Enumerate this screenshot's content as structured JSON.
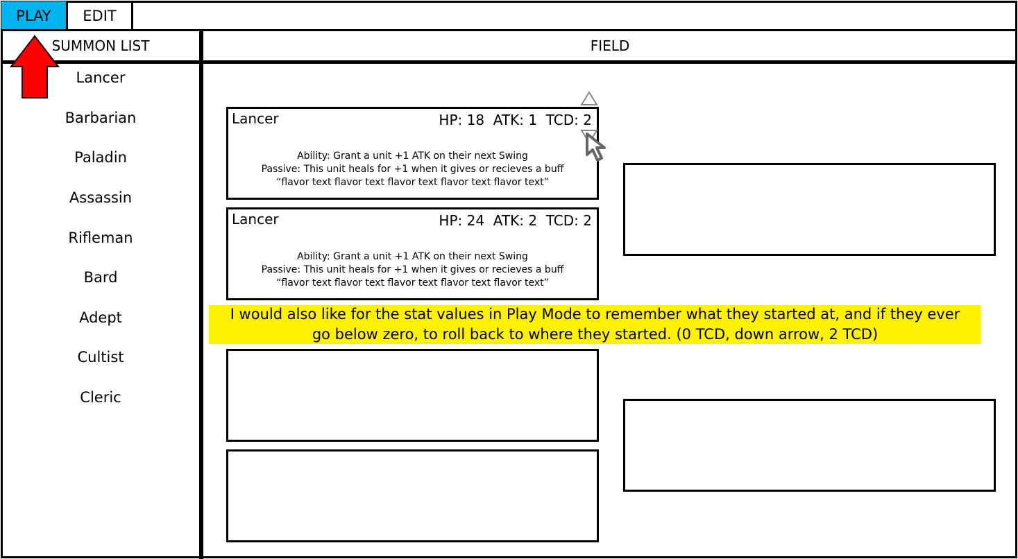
{
  "tabs": {
    "play": "PLAY",
    "edit": "EDIT"
  },
  "headers": {
    "summon_list": "SUMMON LIST",
    "field": "FIELD"
  },
  "summon_list": [
    "Lancer",
    "Barbarian",
    "Paladin",
    "Assassin",
    "Rifleman",
    "Bard",
    "Adept",
    "Cultist",
    "Cleric"
  ],
  "cards": [
    {
      "name": "Lancer",
      "stats": "HP: 18  ATK: 1  TCD: 2",
      "ability": "Ability: Grant a unit +1 ATK on their next Swing",
      "passive": "Passive: This unit heals for +1 when it gives or recieves a buff",
      "flavor": "“flavor text flavor text flavor text flavor text flavor text”"
    },
    {
      "name": "Lancer",
      "stats": "HP: 24  ATK: 2  TCD: 2",
      "ability": "Ability: Grant a unit +1 ATK on their next Swing",
      "passive": "Passive: This unit heals for +1 when it gives or recieves a buff",
      "flavor": "“flavor text flavor text flavor text flavor text flavor text”"
    }
  ],
  "note": {
    "line1": "I would also like for the stat values in Play Mode to remember what they started at, and if they ever",
    "line2": "go below zero, to roll back to where they started. (0 TCD, down arrow, 2 TCD)"
  },
  "colors": {
    "play_tab": "#00b4f0",
    "note_highlight": "#fff200",
    "arrow": "#ff0000"
  },
  "icons": {
    "annotation_arrow": "up-arrow-icon",
    "stepper_up": "triangle-up-icon",
    "stepper_down": "triangle-down-icon",
    "cursor": "mouse-pointer-icon"
  }
}
